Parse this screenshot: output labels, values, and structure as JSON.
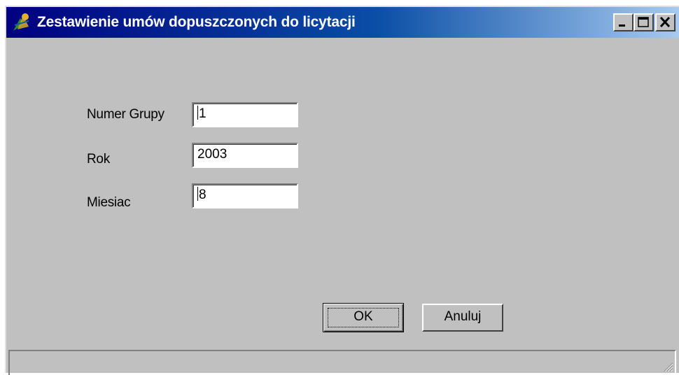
{
  "window": {
    "title": "Zestawienie umów dopuszczonych do licytacji",
    "controls": {
      "minimize_icon": "minimize-icon",
      "maximize_icon": "maximize-icon",
      "close_icon": "close-icon"
    }
  },
  "form": {
    "group_label": "Numer Grupy",
    "group_value": "1",
    "year_label": "Rok",
    "year_value": "2003",
    "month_label": "Miesiac",
    "month_value": "8"
  },
  "buttons": {
    "ok_label": "OK",
    "cancel_label": "Anuluj"
  },
  "colors": {
    "titlebar_start": "#000080",
    "titlebar_end": "#a6caf0",
    "face": "#c0c0c0"
  }
}
